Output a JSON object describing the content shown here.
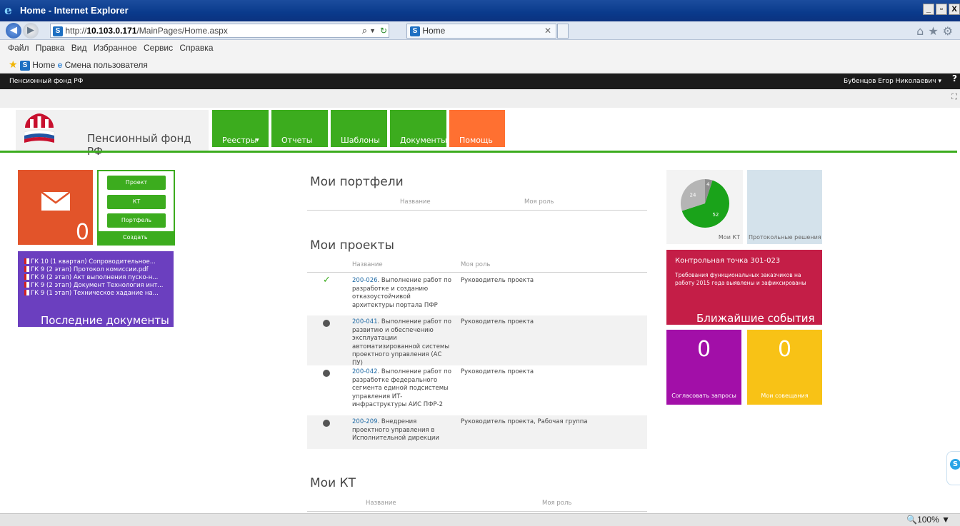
{
  "window": {
    "title": "Home - Internet Explorer",
    "url_prefix": "http://",
    "url_host": "10.103.0.171",
    "url_path": "/MainPages/Home.aspx",
    "tab_title": "Home",
    "menu": [
      "Файл",
      "Правка",
      "Вид",
      "Избранное",
      "Сервис",
      "Справка"
    ],
    "favorites": [
      "Home",
      "Смена пользователя"
    ],
    "zoom": "100%"
  },
  "suite": {
    "brand": "Пенсионный фонд РФ",
    "user": "Бубенцов Егор Николаевич",
    "help": "?"
  },
  "site": {
    "title": "Пенсионный фонд РФ",
    "nav": [
      "Реестры",
      "Отчеты",
      "Шаблоны",
      "Документы",
      "Помощь"
    ]
  },
  "tiles": {
    "mail_count": "0",
    "create_buttons": [
      "Проект",
      "КТ",
      "Портфель"
    ],
    "create_label": "Создать",
    "docs": [
      "ГК 10 (1 квартал) Сопроводительное...",
      "ГК 9 (2 этап) Протокол комиссии.pdf",
      "ГК 9 (2 этап) Акт выполнения пуско-н...",
      "ГК 9 (2 этап) Документ Технология инт...",
      "ГК 9 (1 этап) Техническое хадание на..."
    ],
    "docs_title": "Последние документы",
    "kt_label": "Мои КТ",
    "protocol_label": "Протокольные решения",
    "events_kt": "Контрольная точка 301-023",
    "events_desc": "Требования функциональных заказчиков на работу 2015 года выявлены и зафиксированы",
    "events_title": "Ближайшие события",
    "agree_count": "0",
    "agree_label": "Согласовать запросы",
    "meetings_count": "0",
    "meetings_label": "Мои совещания"
  },
  "portfolios": {
    "title": "Мои портфели",
    "col_name": "Название",
    "col_role": "Моя роль"
  },
  "projects": {
    "title": "Мои проекты",
    "col_name": "Название",
    "col_role": "Моя роль",
    "rows": [
      {
        "code": "200-026",
        "name": ". Выполнение работ по разработке и созданию отказоустойчивой архитектуры портала ПФР",
        "role": "Руководитель проекта",
        "status": "done"
      },
      {
        "code": "200-041",
        "name": ". Выполнение работ по развитию и обеспечению эксплуатации автоматизированной системы проектного управления (АС ПУ)",
        "role": "Руководитель проекта",
        "status": "active"
      },
      {
        "code": "200-042",
        "name": ". Выполнение работ по разработке федерального сегмента единой подсистемы управления ИТ-инфраструктуры АИС ПФР-2",
        "role": "Руководитель проекта",
        "status": "active"
      },
      {
        "code": "200-209",
        "name": ". Внедрения проектного управления в Исполнительной дирекции",
        "role": "Руководитель проекта, Рабочая группа",
        "status": "active"
      }
    ]
  },
  "kts": {
    "title": "Мои КТ",
    "col_name": "Название",
    "col_role": "Моя роль"
  },
  "chart_data": {
    "type": "pie",
    "categories": [
      "52",
      "24",
      "4"
    ],
    "values": [
      52,
      24,
      4
    ],
    "colors": [
      "#1aa31a",
      "#b5b5b5",
      "#8e8e8e"
    ]
  }
}
